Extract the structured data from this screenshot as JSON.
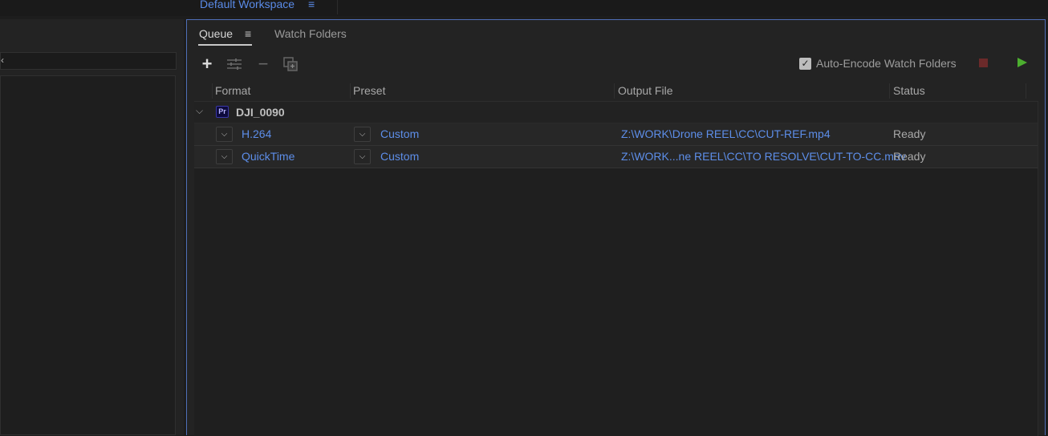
{
  "workspace": {
    "label": "Default Workspace"
  },
  "tabs": [
    {
      "label": "Queue"
    },
    {
      "label": "Watch Folders"
    }
  ],
  "toolbar": {
    "auto_encode_label": "Auto-Encode Watch Folders",
    "auto_encode_checked": true
  },
  "table": {
    "headers": [
      "Format",
      "Preset",
      "Output File",
      "Status"
    ],
    "group": {
      "badge": "Pr",
      "name": "DJI_0090"
    },
    "rows": [
      {
        "format": "H.264",
        "preset": "Custom",
        "output": "Z:\\WORK\\Drone REEL\\CC\\CUT-REF.mp4",
        "status": "Ready"
      },
      {
        "format": "QuickTime",
        "preset": "Custom",
        "output": "Z:\\WORK...ne REEL\\CC\\TO RESOLVE\\CUT-TO-CC.mov",
        "status": "Ready"
      }
    ]
  },
  "colors": {
    "accent_blue": "#5d8ee9",
    "play_green": "#4caf2f",
    "stop_red": "#6b2a2a",
    "panel_border": "#4f6fb8"
  }
}
